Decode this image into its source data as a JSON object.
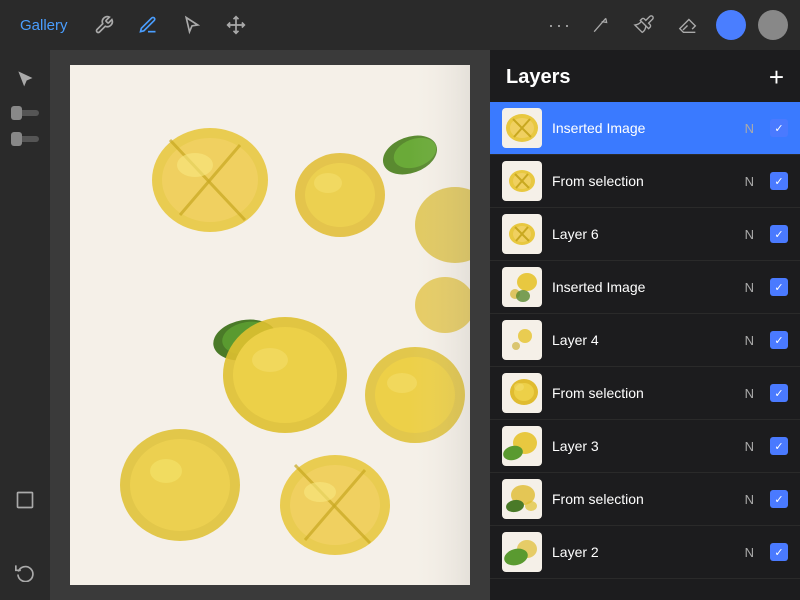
{
  "toolbar": {
    "gallery_label": "Gallery",
    "dots_label": "···",
    "add_label": "+"
  },
  "layers": {
    "title": "Layers",
    "add_btn": "+",
    "items": [
      {
        "id": 0,
        "name": "Inserted Image",
        "blend": "N",
        "visible": true,
        "active": true,
        "thumb": "lemon_slice"
      },
      {
        "id": 1,
        "name": "From selection",
        "blend": "N",
        "visible": true,
        "active": false,
        "thumb": "lemon_slice_small"
      },
      {
        "id": 2,
        "name": "Layer 6",
        "blend": "N",
        "visible": true,
        "active": false,
        "thumb": "lemon_slice_small"
      },
      {
        "id": 3,
        "name": "Inserted Image",
        "blend": "N",
        "visible": true,
        "active": false,
        "thumb": "lemon_dots"
      },
      {
        "id": 4,
        "name": "Layer 4",
        "blend": "N",
        "visible": true,
        "active": false,
        "thumb": "lemon_dots_small"
      },
      {
        "id": 5,
        "name": "From selection",
        "blend": "N",
        "visible": true,
        "active": false,
        "thumb": "lemon_whole"
      },
      {
        "id": 6,
        "name": "Layer 3",
        "blend": "N",
        "visible": true,
        "active": false,
        "thumb": "lemon_whole_green"
      },
      {
        "id": 7,
        "name": "From selection",
        "blend": "N",
        "visible": true,
        "active": false,
        "thumb": "lemon_green_mix"
      },
      {
        "id": 8,
        "name": "Layer 2",
        "blend": "N",
        "visible": true,
        "active": false,
        "thumb": "lemon_green"
      }
    ]
  },
  "sidebar": {
    "tools": [
      "✏️",
      "◻",
      "↺"
    ]
  }
}
